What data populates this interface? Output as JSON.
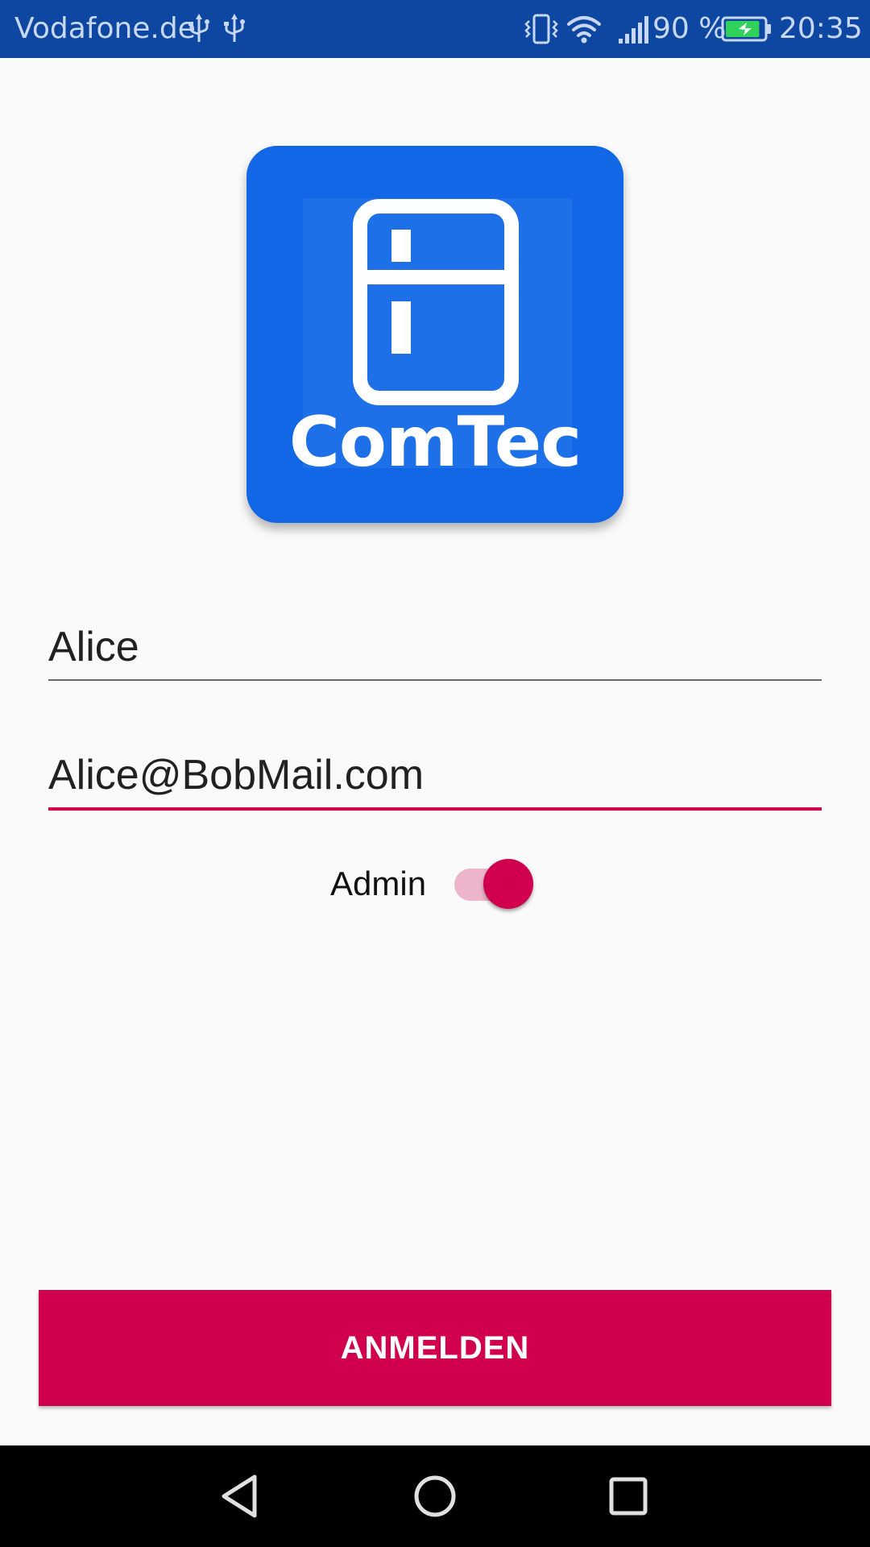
{
  "status_bar": {
    "carrier": "Vodafone.de",
    "battery_percent": "90 %",
    "time": "20:35",
    "battery_level": 0.9,
    "icons": [
      "usb-icon",
      "usb-icon",
      "vibrate-icon",
      "wifi-icon",
      "signal-icon",
      "battery-charging-icon"
    ]
  },
  "logo": {
    "brand_text": "ComTec",
    "icon": "fridge-icon",
    "color": "#1167e5"
  },
  "form": {
    "name_value": "Alice",
    "email_value": "Alice@BobMail.com",
    "admin_label": "Admin",
    "admin_checked": true
  },
  "button": {
    "label": "ANMELDEN"
  },
  "navigation": {
    "icons": [
      "back-icon",
      "home-icon",
      "recents-icon"
    ]
  },
  "colors": {
    "accent": "#d0004f",
    "status_bar": "#0d47a1",
    "background": "#fafafa"
  }
}
